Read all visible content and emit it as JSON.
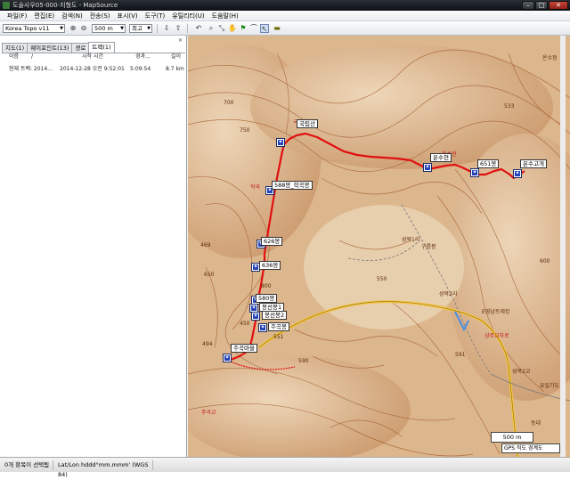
{
  "window": {
    "title": "도솔사우05-000-지형도 - MapSource",
    "buttons": {
      "minimize": "–",
      "maximize": "□",
      "close": "✕"
    }
  },
  "menu": [
    "파일(F)",
    "편집(E)",
    "검색(N)",
    "전송(S)",
    "표시(V)",
    "도구(T)",
    "유틸리티(U)",
    "도움말(H)"
  ],
  "toolbar": {
    "map_product": "Korea Topo v11",
    "zoom_scale": "500 m",
    "detail_level": "최고"
  },
  "left_panel": {
    "tabs": [
      "지도(1)",
      "웨이포인트(13)",
      "경로",
      "트랙(1)"
    ],
    "selected_tab": 3,
    "columns": [
      "이름",
      "/",
      "시작 시간",
      "경과...",
      "길이"
    ],
    "rows": [
      {
        "name": "현재 트랙: 2014...",
        "start": "2014-12-28 오전 9:52:01",
        "elapsed": "5:09:54",
        "length": "8.7 km"
      }
    ]
  },
  "map": {
    "track_color": "#e01010",
    "waypoints": [
      {
        "label": "국립산"
      },
      {
        "label": "온수현"
      },
      {
        "label": "651봉"
      },
      {
        "label": "온수고개"
      },
      {
        "label": "588봉_학곡봉"
      },
      {
        "label": "626봉"
      },
      {
        "label": "636봉"
      },
      {
        "label": "580봉"
      },
      {
        "label": "봉선봉1"
      },
      {
        "label": "봉선봉2"
      },
      {
        "label": "주곡봉"
      },
      {
        "label": "주곡마을"
      }
    ],
    "contour_labels": [
      "700",
      "750",
      "800",
      "450",
      "650",
      "550",
      "600",
      "533",
      "591",
      "590",
      "494",
      "469",
      "551"
    ],
    "place_labels": [
      "성북1리",
      "구름봉",
      "성북2리",
      "E영남트레킹",
      "상주교차로",
      "성북2교",
      "유일기도",
      "등대",
      "온수정"
    ],
    "red_labels": [
      "국립산",
      "학곡",
      "온수현",
      "주곡교"
    ],
    "scale": "500 m",
    "gps_box": "GPS 직도 경계도"
  },
  "status": {
    "selection": "0개 항목이 선택됨",
    "position_format": "Lat/Lon hddd°mm.mmm' (WGS 84)"
  }
}
